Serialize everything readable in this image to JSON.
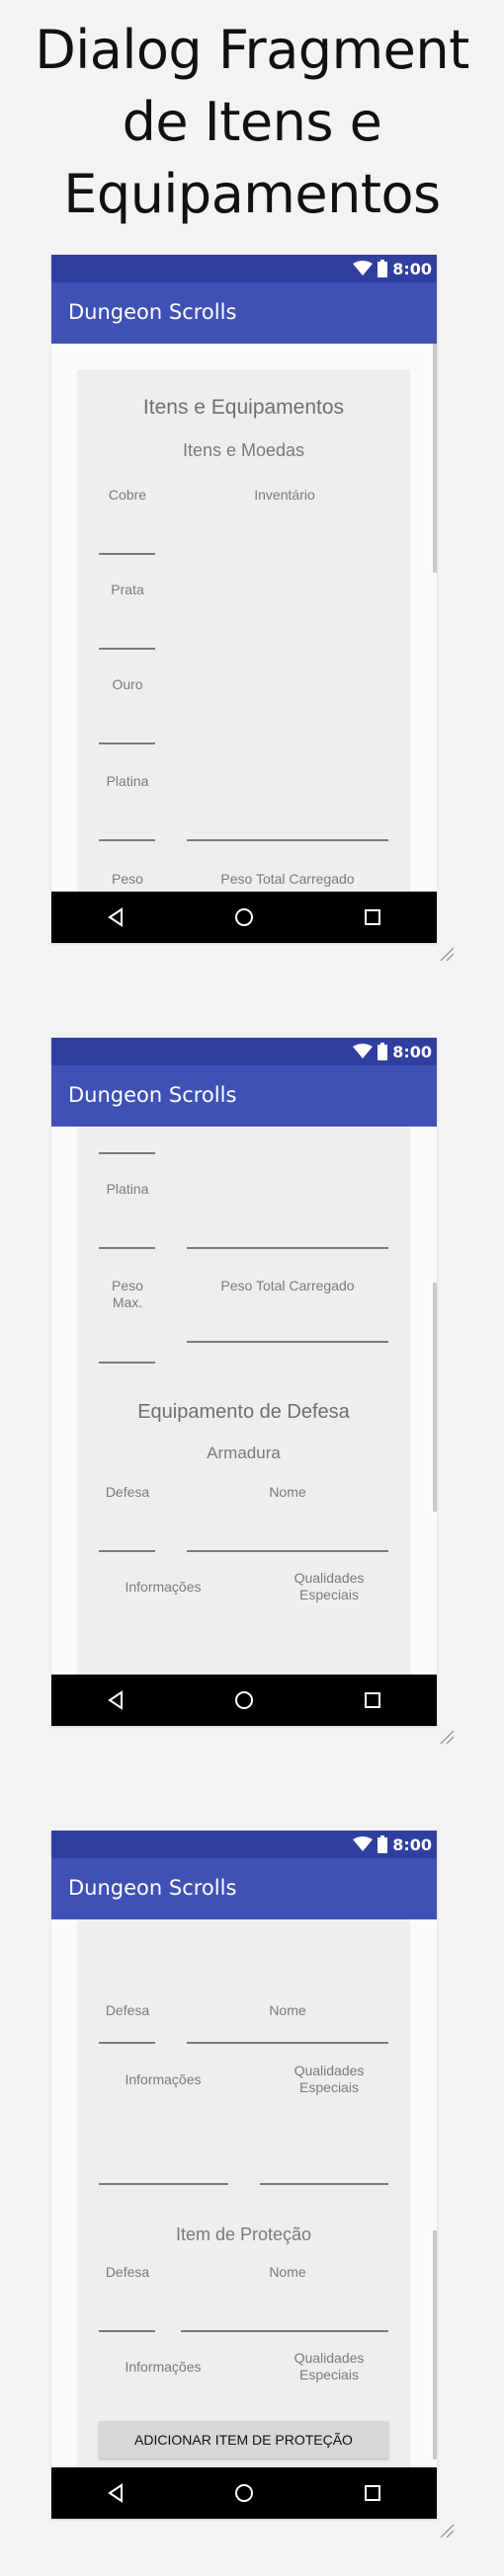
{
  "page_title": {
    "line1": "Dialog Fragment",
    "line2": "de Itens e",
    "line3": "Equipamentos"
  },
  "status_bar": {
    "time": "8:00",
    "icons": [
      "wifi-icon",
      "battery-icon"
    ]
  },
  "app_bar": {
    "title": "Dungeon Scrolls"
  },
  "nav_bar": {
    "icons": [
      "back-icon",
      "home-icon",
      "recents-icon"
    ]
  },
  "screen1": {
    "dialog_title": "Itens e Equipamentos",
    "section_title": "Itens e Moedas",
    "labels": {
      "cobre": "Cobre",
      "inventario": "Inventário",
      "prata": "Prata",
      "ouro": "Ouro",
      "platina": "Platina",
      "peso": "Peso",
      "peso_total": "Peso Total Carregado"
    }
  },
  "screen2": {
    "labels": {
      "platina": "Platina",
      "peso_max": "Peso\nMax.",
      "peso_total": "Peso Total Carregado",
      "defesa": "Defesa",
      "nome": "Nome",
      "informacoes": "Informações",
      "qualidades": "Qualidades\nEspeciais"
    },
    "section_title": "Equipamento de Defesa",
    "subsection_title": "Armadura"
  },
  "screen3": {
    "labels": {
      "defesa_cut": "Defesa",
      "nome_cut": "Nome",
      "informacoes": "Informações",
      "qualidades": "Qualidades\nEspeciais",
      "defesa": "Defesa",
      "nome": "Nome",
      "informacoes2": "Informações",
      "qualidades2": "Qualidades\nEspeciais"
    },
    "section_title": "Item de Proteção",
    "add_button": "ADICIONAR ITEM DE PROTEÇÃO"
  }
}
